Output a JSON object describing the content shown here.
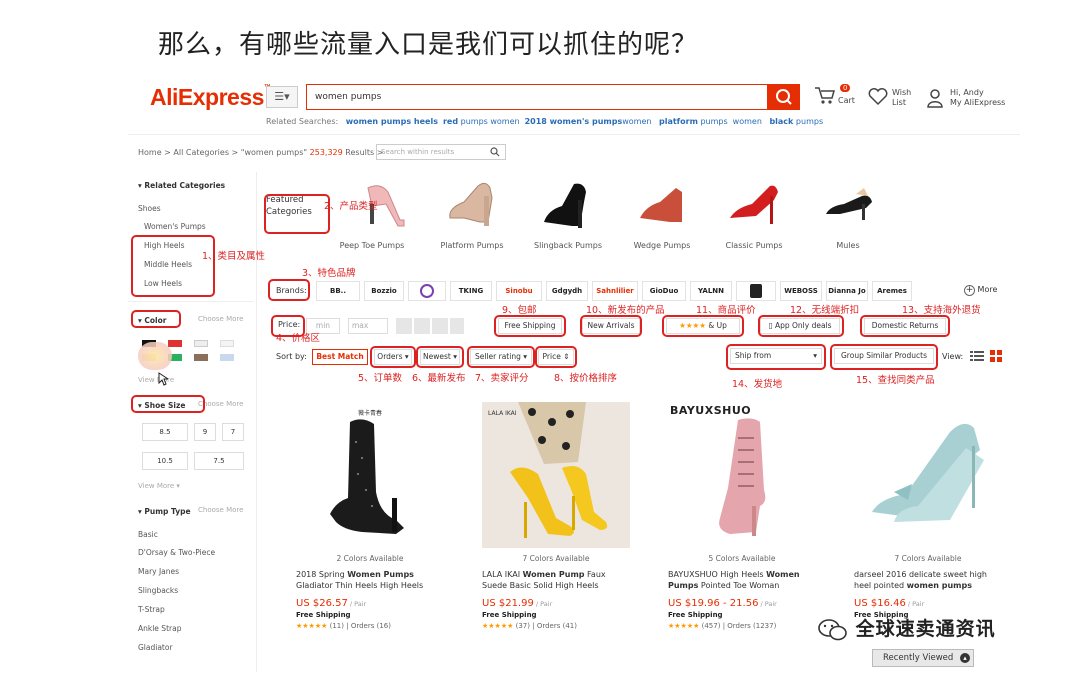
{
  "slide_title": "那么，有哪些流量入口是我们可以抓住的呢？",
  "header": {
    "logo": "AliExpress",
    "logo_mark": "™",
    "search_value": "women pumps",
    "cart_count": "0",
    "cart_label": "Cart",
    "wish_label": "Wish",
    "wish_label2": "List",
    "user_greeting": "Hi, Andy",
    "user_account": "My AliExpress"
  },
  "related": {
    "label": "Related Searches:",
    "items": [
      {
        "b": "women pumps heels",
        "t": ""
      },
      {
        "b": "red",
        "t": " pumps women"
      },
      {
        "b": "2018 women's pumps",
        "t": ""
      },
      {
        "b": "",
        "t": "women "
      },
      {
        "b": "platform",
        "t": " pumps"
      },
      {
        "b": "",
        "t": "women "
      },
      {
        "b": "black",
        "t": " pumps"
      }
    ]
  },
  "breadcrumb": {
    "path": "Home > All Categories > \"women pumps\"",
    "count": "253,329",
    "results": "Results >",
    "within_placeholder": "Search within results"
  },
  "sidebar": {
    "related_categories": "Related Categories",
    "shoes": "Shoes",
    "womens_pumps": "Women's Pumps",
    "cats": [
      "High Heels",
      "Middle Heels",
      "Low Heels"
    ],
    "color": "Color",
    "choose_more": "Choose More",
    "view_more": "View More",
    "shoe_size": "Shoe Size",
    "sizes": [
      "8.5",
      "9",
      "7",
      "10.5",
      "7.5"
    ],
    "view_more2": "View More",
    "pump_type": "Pump Type",
    "types": [
      "Basic",
      "D'Orsay & Two-Piece",
      "Mary Janes",
      "Slingbacks",
      "T-Strap",
      "Ankle Strap",
      "Gladiator"
    ]
  },
  "featured": {
    "label1": "Featured",
    "label2": "Categories",
    "products": [
      "Peep Toe Pumps",
      "Platform Pumps",
      "Slingback Pumps",
      "Wedge Pumps",
      "Classic Pumps",
      "Mules"
    ]
  },
  "brands": {
    "label": "Brands:",
    "items": [
      "BB..",
      "Bozzio",
      "",
      "TKING",
      "Sinobu",
      "Gdgydh",
      "Sahnlilier",
      "GioDuo",
      "YALNN",
      "",
      "WEBOSS",
      "Dianna Jo",
      "Aremes"
    ],
    "more": "More"
  },
  "filters": {
    "price": "Price:",
    "min": "min",
    "max": "max",
    "free_shipping": "Free Shipping",
    "new_arrivals": "New Arrivals",
    "up": "& Up",
    "app_only": "App Only deals",
    "domestic": "Domestic Returns"
  },
  "sort": {
    "label": "Sort by:",
    "best": "Best Match",
    "orders": "Orders",
    "newest": "Newest",
    "seller": "Seller rating",
    "price": "Price",
    "ship_from": "Ship from",
    "group": "Group Similar Products",
    "view": "View:"
  },
  "annotations": {
    "a1": "1、类目及属性",
    "a2": "2、产品类型",
    "a3": "3、特色品牌",
    "a4": "4、价格区",
    "a5": "5、订单数",
    "a6": "6、最新发布",
    "a7": "7、卖家评分",
    "a8": "8、按价格排序",
    "a9": "9、包邮",
    "a10": "10、新发布的产品",
    "a11": "11、商品评价",
    "a12": "12、无线端折扣",
    "a13": "13、支持海外退货",
    "a14": "14、发货地",
    "a15": "15、查找同类产品"
  },
  "products": [
    {
      "colors": "2 Colors Available",
      "t1": "2018 Spring ",
      "tb": "Women Pumps",
      "t2": " Gladiator Thin Heels High Heels",
      "price": "US $26.57",
      "unit": " / Pair",
      "ship": "Free Shipping",
      "stars": "★★★★★",
      "rev": "(11)",
      "orders": "Orders (16)",
      "brand_text": "薇卡青春"
    },
    {
      "colors": "7 Colors Available",
      "t1": "LALA IKAI ",
      "tb": "Women Pump",
      "t2": " Faux Suede Basic Solid High Heels",
      "price": "US $21.99",
      "unit": " / Pair",
      "ship": "Free Shipping",
      "stars": "★★★★★",
      "rev": "(37)",
      "orders": "Orders (41)",
      "brand_text": "LALA IKAI"
    },
    {
      "colors": "5 Colors Available",
      "t1": "BAYUXSHUO High Heels ",
      "tb": "Women Pumps",
      "t2": " Pointed Toe Woman",
      "price": "US $19.96 - 21.56",
      "unit": " / Pair",
      "ship": "Free Shipping",
      "stars": "★★★★★",
      "rev": "(457)",
      "orders": "Orders (1237)",
      "brand_text": "BAYUXSHUO"
    },
    {
      "colors": "7 Colors Available",
      "t1": "darseel 2016 delicate sweet high heel pointed ",
      "tb": "women pumps",
      "t2": "",
      "price": "US $16.46",
      "unit": " / Pair",
      "ship": "Free Shipping",
      "stars": "★★★★★",
      "rev": "",
      "orders": "",
      "brand_text": ""
    }
  ],
  "watermark": "全球速卖通资讯",
  "recently_viewed": "Recently Viewed",
  "colors": {
    "accent": "#e62e04",
    "annotation": "#dd2222",
    "link": "#2a6db5",
    "star": "#ff9900"
  }
}
